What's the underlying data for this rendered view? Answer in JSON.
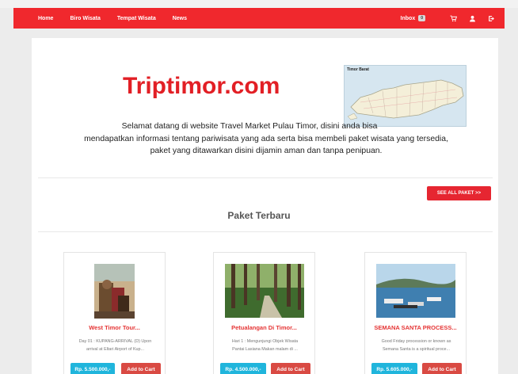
{
  "nav": {
    "links": [
      "Home",
      "Biro Wisata",
      "Tempat Wisata",
      "News"
    ],
    "inbox_label": "Inbox",
    "inbox_count": "0",
    "icons": [
      "cart-icon",
      "user-icon",
      "logout-icon"
    ]
  },
  "header": {
    "title": "Triptimor.com",
    "map_label": "Timor Barat",
    "welcome_lines": [
      "Selamat datang di website Travel Market Pulau Timor, disini anda bisa",
      "mendapatkan informasi tentang pariwisata yang ada serta bisa membeli paket wisata yang tersedia,",
      "paket yang ditawarkan disini dijamin aman dan tanpa penipuan."
    ]
  },
  "packages": {
    "see_all_label": "SEE ALL PAKET >>",
    "section_title": "Paket Terbaru",
    "cart_label": "Add to Cart",
    "items": [
      {
        "title": "West Timor Tour...",
        "desc_lines": [
          "Day 01 : KUPANG-ARRIVAL (D) Upon",
          "arrival at Eltari Airport of Kup..."
        ],
        "price": "Rp. 5.500.000,-"
      },
      {
        "title": "Petualangan Di Timor...",
        "desc_lines": [
          "Hari 1 : Mengunjungi Objek Wisata",
          "Pantai Lasiana Makan malam di ..."
        ],
        "price": "Rp. 4.500.000,-"
      },
      {
        "title": "SEMANA SANTA PROCESS...",
        "desc_lines": [
          "Good Friday procession or known as",
          "Semana Santa is a spiritual proce..."
        ],
        "price": "Rp. 5.605.000,-"
      }
    ]
  },
  "colors": {
    "brand_red": "#f0282d",
    "title_red": "#e21f25",
    "price_blue": "#20b5dc",
    "cart_red": "#d94a43"
  }
}
